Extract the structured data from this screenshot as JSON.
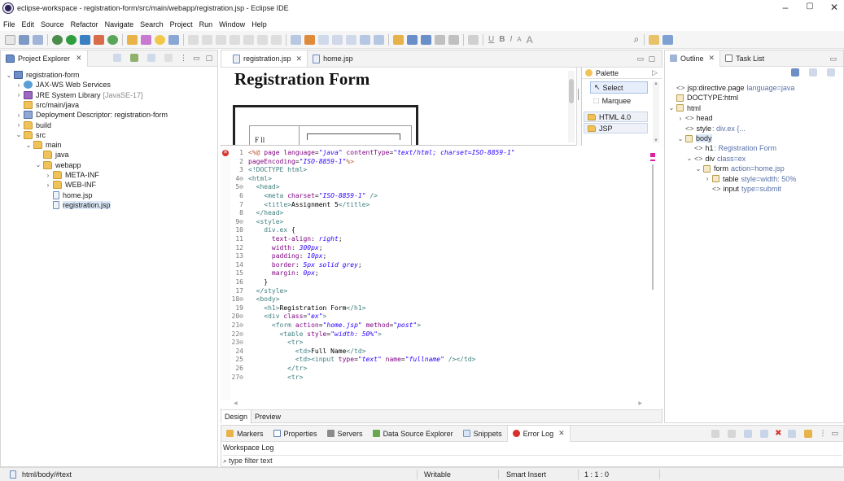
{
  "window": {
    "title": "eclipse-workspace - registration-form/src/main/webapp/registration.jsp - Eclipse IDE",
    "minimize": "–",
    "maximize": "▢",
    "close": "✕"
  },
  "menu": [
    "File",
    "Edit",
    "Source",
    "Refactor",
    "Navigate",
    "Search",
    "Project",
    "Run",
    "Window",
    "Help"
  ],
  "project_explorer": {
    "tab_label": "Project Explorer",
    "items": [
      {
        "label": "registration-form",
        "depth": 0,
        "chev": "⌄",
        "icon": "project-icon"
      },
      {
        "label": "JAX-WS Web Services",
        "depth": 1,
        "chev": "›",
        "icon": "webservice-icon"
      },
      {
        "label": "JRE System Library",
        "suffix": "[JavaSE-17]",
        "depth": 1,
        "chev": "›",
        "icon": "library-icon"
      },
      {
        "label": "src/main/java",
        "depth": 1,
        "chev": "",
        "icon": "source-folder-icon"
      },
      {
        "label": "Deployment Descriptor: registration-form",
        "depth": 1,
        "chev": "›",
        "icon": "descriptor-icon"
      },
      {
        "label": "build",
        "depth": 1,
        "chev": "›",
        "icon": "folder-icon"
      },
      {
        "label": "src",
        "depth": 1,
        "chev": "⌄",
        "icon": "folder-icon"
      },
      {
        "label": "main",
        "depth": 2,
        "chev": "⌄",
        "icon": "folder-icon"
      },
      {
        "label": "java",
        "depth": 3,
        "chev": "",
        "icon": "folder-icon"
      },
      {
        "label": "webapp",
        "depth": 3,
        "chev": "⌄",
        "icon": "folder-icon"
      },
      {
        "label": "META-INF",
        "depth": 4,
        "chev": "›",
        "icon": "folder-icon"
      },
      {
        "label": "WEB-INF",
        "depth": 4,
        "chev": "›",
        "icon": "folder-icon"
      },
      {
        "label": "home.jsp",
        "depth": 4,
        "chev": "",
        "icon": "jsp-file-icon"
      },
      {
        "label": "registration.jsp",
        "depth": 4,
        "chev": "",
        "icon": "jsp-file-icon"
      }
    ]
  },
  "editor": {
    "tabs": [
      {
        "label": "registration.jsp",
        "active": true
      },
      {
        "label": "home.jsp",
        "active": false
      }
    ],
    "design_heading": "Registration Form",
    "design_cell": "F ll",
    "bottom_tabs": [
      "Design",
      "Preview"
    ],
    "code_lines": [
      {
        "n": "1",
        "html": "<span class='dir'>&lt;%@</span> <span class='at'>page</span> <span class='at'>language</span>=<span class='st'>\"java\"</span> <span class='at'>contentType</span>=<span class='st'>\"text/html; charset=ISO-8859-1\"</span>"
      },
      {
        "n": "2",
        "html": "<span class='at'>pageEncoding</span>=<span class='st'>\"ISO-8859-1\"</span><span class='dir'>%&gt;</span>"
      },
      {
        "n": "3",
        "html": "<span class='tg'>&lt;!DOCTYPE html&gt;</span>"
      },
      {
        "n": "4⊖",
        "html": "<span class='tg'>&lt;html&gt;</span>"
      },
      {
        "n": "5⊖",
        "html": "  <span class='tg'>&lt;head&gt;</span>"
      },
      {
        "n": "6",
        "html": "    <span class='tg'>&lt;meta</span> <span class='at'>charset</span>=<span class='st'>\"ISO-8859-1\"</span> <span class='tg'>/&gt;</span>"
      },
      {
        "n": "7",
        "html": "    <span class='tg'>&lt;title&gt;</span><span class='tx'>Assignment 5</span><span class='tg'>&lt;/title&gt;</span>"
      },
      {
        "n": "8",
        "html": "  <span class='tg'>&lt;/head&gt;</span>"
      },
      {
        "n": "9⊖",
        "html": "  <span class='tg'>&lt;style&gt;</span>"
      },
      {
        "n": "10",
        "html": "    <span class='stylename'>div.ex</span> <span class='tx'>{</span>"
      },
      {
        "n": "11",
        "html": "      <span class='prop'>text-align</span>: <span class='val'>right</span>;"
      },
      {
        "n": "12",
        "html": "      <span class='prop'>width</span>: <span class='val'>300px</span>;"
      },
      {
        "n": "13",
        "html": "      <span class='prop'>padding</span>: <span class='val'>10px</span>;"
      },
      {
        "n": "14",
        "html": "      <span class='prop'>border</span>: <span class='val'>5px solid grey</span>;"
      },
      {
        "n": "15",
        "html": "      <span class='prop'>margin</span>: <span class='val'>0px</span>;"
      },
      {
        "n": "16",
        "html": "    <span class='tx'>}</span>"
      },
      {
        "n": "17",
        "html": "  <span class='tg'>&lt;/style&gt;</span>"
      },
      {
        "n": "18⊖",
        "html": "  <span class='tg'>&lt;body&gt;</span>"
      },
      {
        "n": "19",
        "html": "    <span class='tg'>&lt;h1&gt;</span><span class='tx'>Registration Form</span><span class='tg'>&lt;/h1&gt;</span>"
      },
      {
        "n": "20⊖",
        "html": "    <span class='tg'>&lt;div</span> <span class='at'>class</span>=<span class='st'>\"ex\"</span><span class='tg'>&gt;</span>"
      },
      {
        "n": "21⊖",
        "html": "      <span class='tg'>&lt;form</span> <span class='at'>action</span>=<span class='st'>\"home.jsp\"</span> <span class='at'>method</span>=<span class='st'>\"post\"</span><span class='tg'>&gt;</span>"
      },
      {
        "n": "22⊖",
        "html": "        <span class='tg'>&lt;table</span> <span class='at'>style</span>=<span class='st'>\"width: 50%\"</span><span class='tg'>&gt;</span>"
      },
      {
        "n": "23⊖",
        "html": "          <span class='tg'>&lt;tr&gt;</span>"
      },
      {
        "n": "24",
        "html": "            <span class='tg'>&lt;td&gt;</span><span class='tx'>Full Name</span><span class='tg'>&lt;/td&gt;</span>"
      },
      {
        "n": "25",
        "html": "            <span class='tg'>&lt;td&gt;&lt;input</span> <span class='at'>type</span>=<span class='st'>\"text\"</span> <span class='at'>name</span>=<span class='st'>\"fullname\"</span> <span class='tg'>/&gt;&lt;/td&gt;</span>"
      },
      {
        "n": "26",
        "html": "          <span class='tg'>&lt;/tr&gt;</span>"
      },
      {
        "n": "27⊖",
        "html": "          <span class='tg'>&lt;tr&gt;</span>"
      }
    ]
  },
  "palette": {
    "title": "Palette",
    "items": [
      "Select",
      "Marquee"
    ],
    "drawers": [
      "HTML 4.0",
      "JSP"
    ]
  },
  "outline": {
    "tabs": [
      "Outline",
      "Task List"
    ],
    "items": [
      {
        "tag": "<>",
        "label": "jsp:directive.page",
        "attr": "language=java",
        "depth": 0,
        "chev": ""
      },
      {
        "tag": "",
        "label": "DOCTYPE:html",
        "attr": "",
        "depth": 0,
        "chev": ""
      },
      {
        "tag": "",
        "label": "html",
        "attr": "",
        "depth": 0,
        "chev": "⌄"
      },
      {
        "tag": "<>",
        "label": "head",
        "attr": "",
        "depth": 1,
        "chev": "›"
      },
      {
        "tag": "<>",
        "label": "style",
        "attr": ": div.ex {...",
        "depth": 1,
        "chev": ""
      },
      {
        "tag": "",
        "label": "body",
        "attr": "",
        "depth": 1,
        "chev": "⌄"
      },
      {
        "tag": "<>",
        "label": "h1",
        "attr": ": Registration Form",
        "depth": 2,
        "chev": ""
      },
      {
        "tag": "<>",
        "label": "div",
        "attr": "class=ex",
        "depth": 2,
        "chev": "⌄"
      },
      {
        "tag": "",
        "label": "form",
        "attr": "action=home.jsp",
        "depth": 3,
        "chev": "⌄"
      },
      {
        "tag": "",
        "label": "table",
        "attr": "style=width: 50%",
        "depth": 4,
        "chev": "›"
      },
      {
        "tag": "<>",
        "label": "input",
        "attr": "type=submit",
        "depth": 4,
        "chev": ""
      }
    ]
  },
  "bottom_panel": {
    "tabs": [
      "Markers",
      "Properties",
      "Servers",
      "Data Source Explorer",
      "Snippets",
      "Error Log"
    ],
    "active_tab": "Error Log",
    "subtitle": "Workspace Log",
    "filter_placeholder": "type filter text"
  },
  "status_bar": {
    "path": "html/body/#text",
    "mode": "Writable",
    "insert": "Smart Insert",
    "position": "1 : 1 : 0"
  },
  "colors": {
    "keyword": "#7f0055",
    "string": "#2a00ff",
    "tag": "#3f7f7f",
    "attr": "#7f007f",
    "error": "#d9302b"
  }
}
